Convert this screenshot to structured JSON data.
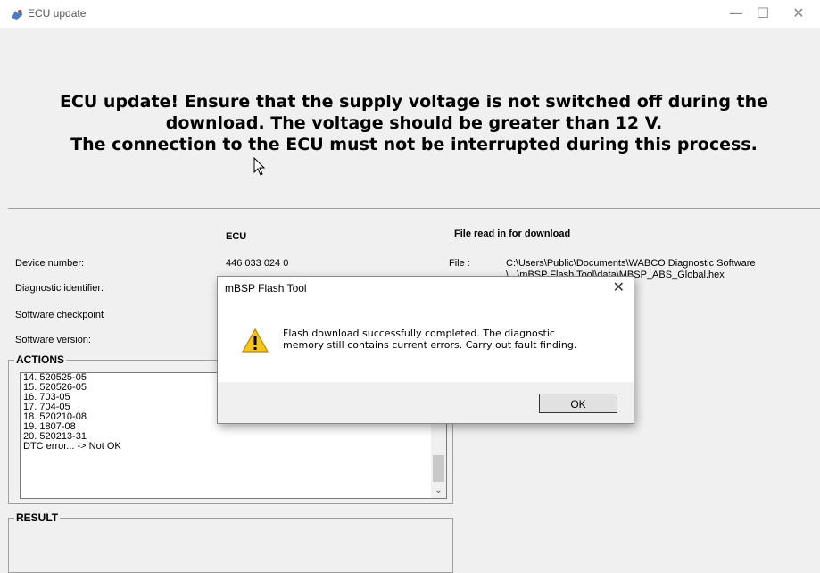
{
  "window": {
    "title": "ECU update",
    "minimize_glyph": "—",
    "maximize_glyph": "☐",
    "close_glyph": "✕",
    "icon": "ecu-app-icon"
  },
  "banner": {
    "line1": "ECU update! Ensure that the supply voltage is not switched off during the",
    "line2": "download. The voltage should be greater than 12 V.",
    "line3": "The connection to the ECU must not be interrupted during this process."
  },
  "info": {
    "ecu_header": "ECU",
    "file_header": "File read in for download",
    "rows": [
      {
        "label": "Device number:",
        "value": "446 033 024 0"
      },
      {
        "label": "Diagnostic identifier:",
        "value": ""
      },
      {
        "label": "Software checkpoint",
        "value": ""
      },
      {
        "label": "Software version:",
        "value": ""
      }
    ],
    "file_label": "File :",
    "file_path_line1": "C:\\Users\\Public\\Documents\\WABCO Diagnostic Software",
    "file_path_line2": "\\...\\mBSP Flash Tool\\data\\MBSP_ABS_Global.hex"
  },
  "actions": {
    "title": "ACTIONS",
    "lines": [
      "14. 520525-05",
      "15. 520526-05",
      "16. 703-05",
      "17. 704-05",
      "18. 520210-08",
      "19. 1807-08",
      "20. 520213-31",
      "DTC error... -> Not OK"
    ]
  },
  "result": {
    "title": "RESULT"
  },
  "dialog": {
    "title": "mBSP Flash Tool",
    "close_glyph": "✕",
    "message_line1": "Flash download successfully completed. The diagnostic",
    "message_line2": "memory still contains current errors. Carry out fault finding.",
    "ok_label": "OK",
    "icon": "warning-icon"
  }
}
